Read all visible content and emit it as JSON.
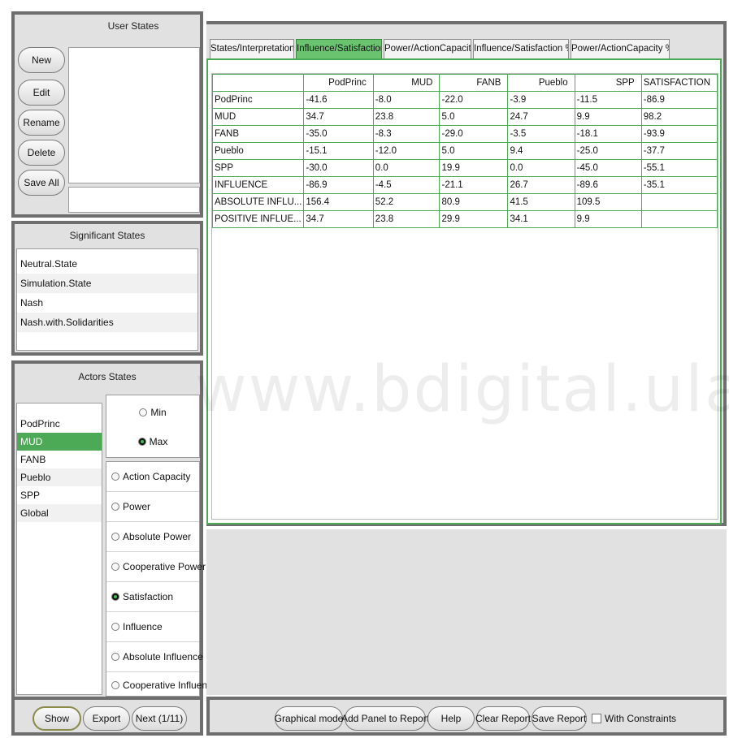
{
  "user_states": {
    "title": "User States",
    "buttons": [
      "New",
      "Edit",
      "Rename",
      "Delete",
      "Save All"
    ],
    "name_value": ""
  },
  "significant_states": {
    "title": "Significant States",
    "items": [
      "Neutral.State",
      "Simulation.State",
      "Nash",
      "Nash.with.Solidarities"
    ]
  },
  "actors_states": {
    "title": "Actors States",
    "actors": [
      "PodPrinc",
      "MUD",
      "FANB",
      "Pueblo",
      "SPP",
      "Global"
    ],
    "selected_actor": "MUD",
    "minmax": [
      "Min",
      "Max"
    ],
    "selected_minmax": "Max",
    "options": [
      "Action Capacity",
      "Power",
      "Absolute Power",
      "Cooperative Power",
      "Satisfaction",
      "Influence",
      "Absolute Influence",
      "Cooperative Influence"
    ],
    "selected_option": "Satisfaction"
  },
  "left_buttons": [
    "Show",
    "Export",
    "Next (1/11)"
  ],
  "tabs": [
    "States/Interpretation",
    "Influence/Satisfaction",
    "Power/ActionCapacity",
    "Influence/Satisfaction %",
    "Power/ActionCapacity %"
  ],
  "active_tab": "Influence/Satisfaction",
  "table": {
    "columns": [
      "",
      "PodPrinc",
      "MUD",
      "FANB",
      "Pueblo",
      "SPP",
      "SATISFACTION"
    ],
    "rows": [
      [
        "PodPrinc",
        "-41.6",
        "-8.0",
        "-22.0",
        "-3.9",
        "-11.5",
        "-86.9"
      ],
      [
        "MUD",
        "34.7",
        "23.8",
        "5.0",
        "24.7",
        "9.9",
        "98.2"
      ],
      [
        "FANB",
        "-35.0",
        "-8.3",
        "-29.0",
        "-3.5",
        "-18.1",
        "-93.9"
      ],
      [
        "Pueblo",
        "-15.1",
        "-12.0",
        "5.0",
        "9.4",
        "-25.0",
        "-37.7"
      ],
      [
        "SPP",
        "-30.0",
        "0.0",
        "19.9",
        "0.0",
        "-45.0",
        "-55.1"
      ],
      [
        "INFLUENCE",
        "-86.9",
        "-4.5",
        "-21.1",
        "26.7",
        "-89.6",
        "-35.1"
      ],
      [
        "ABSOLUTE INFLU...",
        "156.4",
        "52.2",
        "80.9",
        "41.5",
        "109.5",
        ""
      ],
      [
        "POSITIVE INFLUE...",
        "34.7",
        "23.8",
        "29.9",
        "34.1",
        "9.9",
        ""
      ]
    ]
  },
  "bottom_buttons": [
    "Graphical mode",
    "Add Panel to Report",
    "Help",
    "Clear Report",
    "Save Report"
  ],
  "with_constraints_label": "With Constraints",
  "watermark": "www.bdigital.ula.ve",
  "colors": {
    "accent": "#4caa57",
    "frame": "#6e6e6e",
    "panel": "#e1e1e1"
  }
}
